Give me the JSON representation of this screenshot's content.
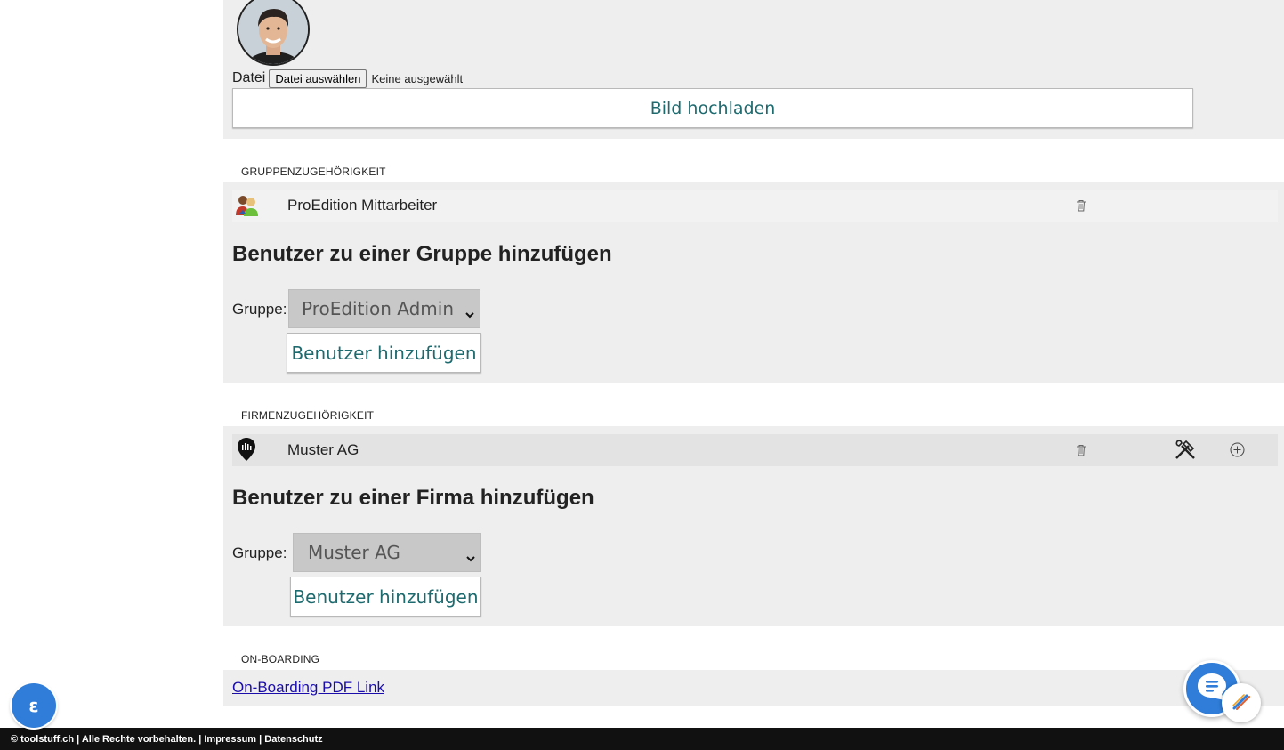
{
  "upload": {
    "file_label": "Datei",
    "choose_button": "Datei auswählen",
    "file_status": "Keine ausgewählt",
    "upload_button": "Bild hochladen"
  },
  "groups": {
    "section_label": "GRUPPENZUGEHÖRIGKEIT",
    "members": [
      {
        "name": "ProEdition Mittarbeiter"
      }
    ],
    "add_heading": "Benutzer zu einer Gruppe hinzufügen",
    "field_label": "Gruppe:",
    "selected": "ProEdition Admin",
    "add_button": "Benutzer hinzufügen"
  },
  "firms": {
    "section_label": "FIRMENZUGEHÖRIGKEIT",
    "members": [
      {
        "name": "Muster AG"
      }
    ],
    "add_heading": "Benutzer zu einer Firma hinzufügen",
    "field_label": "Gruppe:",
    "selected": "Muster AG",
    "add_button": "Benutzer hinzufügen"
  },
  "onboarding": {
    "section_label": "ON-BOARDING",
    "pdf_link": "On-Boarding PDF Link"
  },
  "footer": {
    "text": "© toolstuff.ch | Alle Rechte vorbehalten. | Impressum | Datenschutz"
  },
  "colors": {
    "panel_bg": "#eeeeee",
    "accent_teal": "#1d6a6f",
    "fab_blue": "#2f7dd8",
    "footer_bg": "#111111"
  }
}
